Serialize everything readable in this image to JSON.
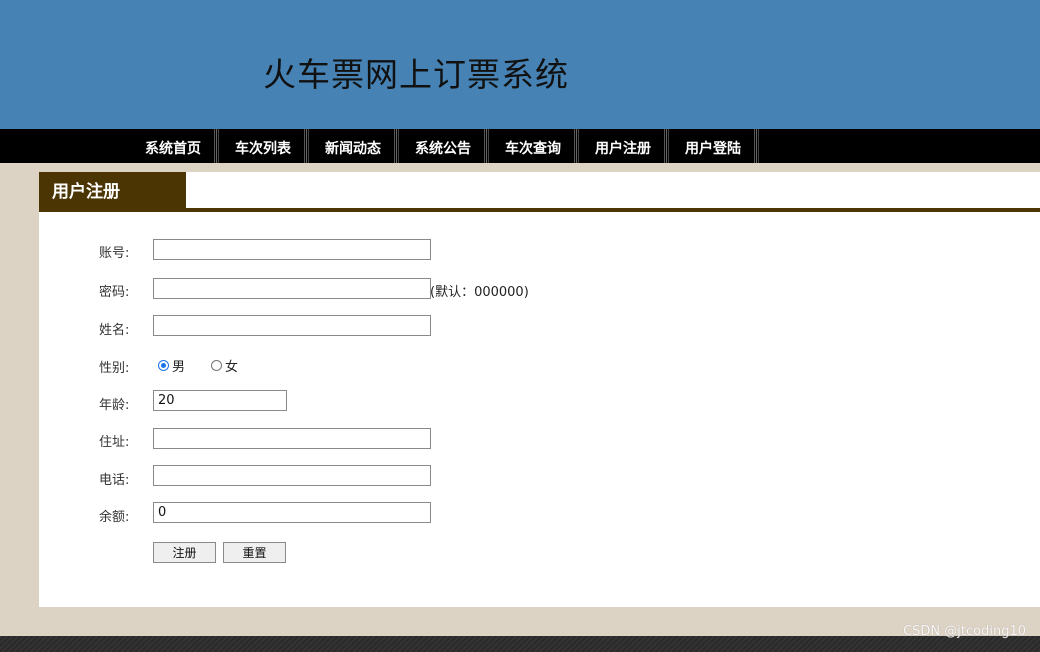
{
  "header": {
    "title": "火车票网上订票系统"
  },
  "nav": {
    "items": [
      {
        "label": "系统首页"
      },
      {
        "label": "车次列表"
      },
      {
        "label": "新闻动态"
      },
      {
        "label": "系统公告"
      },
      {
        "label": "车次查询"
      },
      {
        "label": "用户注册"
      },
      {
        "label": "用户登陆"
      }
    ]
  },
  "section": {
    "title": "用户注册"
  },
  "form": {
    "account": {
      "label": "账号:",
      "value": ""
    },
    "password": {
      "label": "密码:",
      "value": "",
      "hint": "(默认：000000)"
    },
    "name": {
      "label": "姓名:",
      "value": ""
    },
    "gender": {
      "label": "性别:",
      "options": [
        "男",
        "女"
      ],
      "selected": "男"
    },
    "age": {
      "label": "年龄:",
      "value": "20"
    },
    "address": {
      "label": "住址:",
      "value": ""
    },
    "phone": {
      "label": "电话:",
      "value": ""
    },
    "balance": {
      "label": "余额:",
      "value": "0"
    },
    "submit_label": "注册",
    "reset_label": "重置"
  },
  "watermark": "CSDN @jtcoding10",
  "colors": {
    "header_bg": "#4682b4",
    "nav_bg": "#000000",
    "section_tab_bg": "#4a3503",
    "page_bg": "#ddd3c5"
  }
}
